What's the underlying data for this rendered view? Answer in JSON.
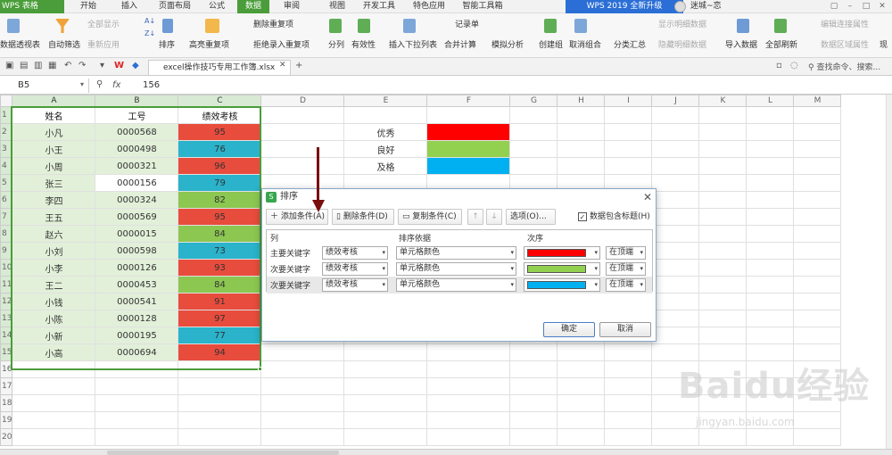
{
  "app": {
    "name": "WPS 表格"
  },
  "menu": {
    "tabs": [
      "开始",
      "插入",
      "页面布局",
      "公式",
      "数据",
      "审阅",
      "视图",
      "开发工具",
      "特色应用",
      "智能工具箱"
    ],
    "active": "数据"
  },
  "promo": "WPS 2019 全新升级",
  "user": {
    "name": "迷城~恋"
  },
  "ribbon": {
    "pivot": "数据透视表",
    "autofilter": "自动筛选",
    "show_all": "全部显示",
    "reapply": "重新应用",
    "sort": "排序",
    "highlight_dup": "高亮重复项",
    "remove_dup": "删除重复项",
    "reject_dup": "拒绝录入重复项",
    "split": "分列",
    "validity": "有效性",
    "insert_dropdown": "插入下拉列表",
    "record": "记录单",
    "consolidate": "合并计算",
    "simulate": "模拟分析",
    "create_group": "创建组",
    "ungroup": "取消组合",
    "subtotal": "分类汇总",
    "show_detail": "显示明细数据",
    "hide_detail": "隐藏明细数据",
    "import": "导入数据",
    "refresh_all": "全部刷新",
    "edit_links": "编辑连接属性",
    "range_props": "数据区域属性",
    "current": "现"
  },
  "quickbar": {
    "file_tab": "excel操作技巧专用工作簿.xlsx",
    "search": "查找命令、搜索..."
  },
  "formula": {
    "name_box": "B5",
    "fx": "fx",
    "value": "156"
  },
  "sheet": {
    "columns": [
      "A",
      "B",
      "C",
      "D",
      "E",
      "F",
      "G",
      "H",
      "I",
      "J",
      "K",
      "L",
      "M"
    ],
    "header_row": [
      "姓名",
      "工号",
      "绩效考核"
    ],
    "rows": [
      [
        "小凡",
        "0000568",
        "95",
        "red"
      ],
      [
        "小王",
        "0000498",
        "76",
        "cyan"
      ],
      [
        "小周",
        "0000321",
        "96",
        "red"
      ],
      [
        "张三",
        "0000156",
        "79",
        "cyan"
      ],
      [
        "李四",
        "0000324",
        "82",
        "green"
      ],
      [
        "王五",
        "0000569",
        "95",
        "red"
      ],
      [
        "赵六",
        "0000015",
        "84",
        "green"
      ],
      [
        "小刘",
        "0000598",
        "73",
        "cyan"
      ],
      [
        "小李",
        "0000126",
        "93",
        "red"
      ],
      [
        "王二",
        "0000453",
        "84",
        "green"
      ],
      [
        "小钱",
        "0000541",
        "91",
        "red"
      ],
      [
        "小陈",
        "0000128",
        "97",
        "red"
      ],
      [
        "小新",
        "0000195",
        "77",
        "cyan"
      ],
      [
        "小高",
        "0000694",
        "94",
        "red"
      ]
    ],
    "key": [
      {
        "label": "优秀",
        "color": "#ff0000"
      },
      {
        "label": "良好",
        "color": "#92d050"
      },
      {
        "label": "及格",
        "color": "#00b0f0"
      }
    ],
    "row_numbers": [
      "1",
      "2",
      "3",
      "4",
      "5",
      "6",
      "7",
      "8",
      "9",
      "10",
      "11",
      "12",
      "13",
      "14",
      "15",
      "16",
      "17",
      "18",
      "19",
      "20"
    ]
  },
  "dialog": {
    "title": "排序",
    "add_condition": "添加条件(A)",
    "delete_condition": "删除条件(D)",
    "copy_condition": "复制条件(C)",
    "options": "选项(O)...",
    "include_header": "数据包含标题(H)",
    "col_header": "列",
    "basis_header": "排序依据",
    "order_header": "次序",
    "rows": [
      {
        "label": "主要关键字",
        "column": "绩效考核",
        "basis": "单元格颜色",
        "color": "#ff0000",
        "position": "在顶端"
      },
      {
        "label": "次要关键字",
        "column": "绩效考核",
        "basis": "单元格颜色",
        "color": "#92d050",
        "position": "在顶端"
      },
      {
        "label": "次要关键字",
        "column": "绩效考核",
        "basis": "单元格颜色",
        "color": "#00b0f0",
        "position": "在顶端"
      }
    ],
    "ok": "确定",
    "cancel": "取消"
  },
  "watermark": {
    "logo": "Baidu经验",
    "url": "jingyan.baidu.com"
  }
}
